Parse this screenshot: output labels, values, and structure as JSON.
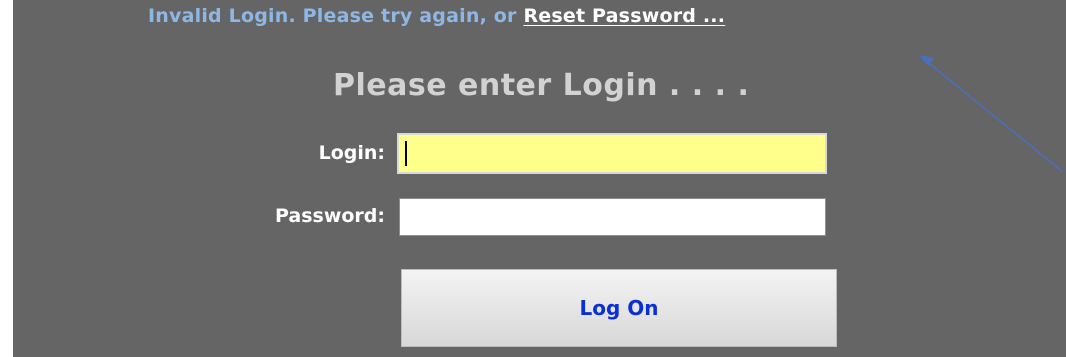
{
  "error": {
    "message": "Invalid Login. Please try again, or ",
    "reset_link": "Reset Password ..."
  },
  "form": {
    "heading": "Please enter Login . . . .",
    "login_label": "Login:",
    "login_value": "",
    "password_label": "Password:",
    "password_value": "",
    "submit_label": "Log On"
  },
  "colors": {
    "background": "#656565",
    "error_text": "#8fb7e6",
    "login_field": "#ffff8c",
    "submit_text": "#0b2fd6",
    "annotation_arrow": "#4a6fc0"
  },
  "annotation": {
    "icon": "arrow-annotation-icon"
  }
}
